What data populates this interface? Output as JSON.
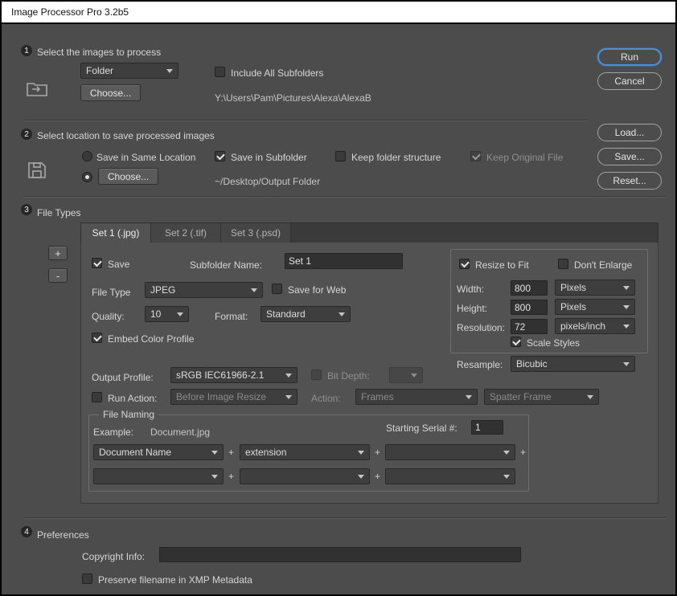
{
  "window": {
    "title": "Image Processor Pro 3.2b5"
  },
  "colors": {
    "accent_blue": "#4f8fd6",
    "window_bg": "#4c4c4c"
  },
  "actions": {
    "run": "Run",
    "cancel": "Cancel",
    "load": "Load...",
    "save": "Save...",
    "reset": "Reset..."
  },
  "section1": {
    "number": "1",
    "title": "Select the images to process",
    "source_select": "Folder",
    "include_subfolders_label": "Include All Subfolders",
    "choose_button": "Choose...",
    "path": "Y:\\Users\\Pam\\Pictures\\Alexa\\AlexaB"
  },
  "section2": {
    "number": "2",
    "title": "Select location to save processed images",
    "same_location_label": "Save in Same Location",
    "save_in_subfolder_label": "Save in Subfolder",
    "keep_folder_structure_label": "Keep folder structure",
    "keep_original_label": "Keep Original File",
    "choose_button": "Choose...",
    "path": "~/Desktop/Output Folder"
  },
  "section3": {
    "number": "3",
    "title": "File Types",
    "add_button": "+",
    "remove_button": "-",
    "tabs": [
      {
        "label": "Set 1 (.jpg)"
      },
      {
        "label": "Set 2 (.tif)"
      },
      {
        "label": "Set 3 (.psd)"
      }
    ],
    "save_label": "Save",
    "subfolder_name_label": "Subfolder Name:",
    "subfolder_name_value": "Set 1",
    "file_type_label": "File Type",
    "file_type_value": "JPEG",
    "save_for_web_label": "Save for Web",
    "quality_label": "Quality:",
    "quality_value": "10",
    "format_label": "Format:",
    "format_value": "Standard",
    "embed_profile_label": "Embed Color Profile",
    "resize": {
      "resize_to_fit_label": "Resize to Fit",
      "dont_enlarge_label": "Don't Enlarge",
      "width_label": "Width:",
      "width_value": "800",
      "width_unit": "Pixels",
      "height_label": "Height:",
      "height_value": "800",
      "height_unit": "Pixels",
      "resolution_label": "Resolution:",
      "resolution_value": "72",
      "resolution_unit": "pixels/inch",
      "scale_styles_label": "Scale Styles",
      "resample_label": "Resample:",
      "resample_value": "Bicubic"
    },
    "output_profile_label": "Output Profile:",
    "output_profile_value": "sRGB IEC61966-2.1",
    "bit_depth_label": "Bit Depth:",
    "bit_depth_value": "",
    "run_action_label": "Run Action:",
    "run_action_value": "Before Image Resize",
    "action_label": "Action:",
    "action_value": "Frames",
    "action_detail_value": "Spatter Frame",
    "file_naming": {
      "legend": "File Naming",
      "example_label": "Example:",
      "example_value": "Document.jpg",
      "serial_label": "Starting Serial #:",
      "serial_value": "1",
      "plus": "+",
      "row1": [
        "Document Name",
        "extension",
        ""
      ],
      "row2": [
        "",
        "",
        ""
      ]
    }
  },
  "section4": {
    "number": "4",
    "title": "Preferences",
    "copyright_label": "Copyright Info:",
    "copyright_value": "",
    "preserve_filename_label": "Preserve filename in XMP Metadata"
  }
}
